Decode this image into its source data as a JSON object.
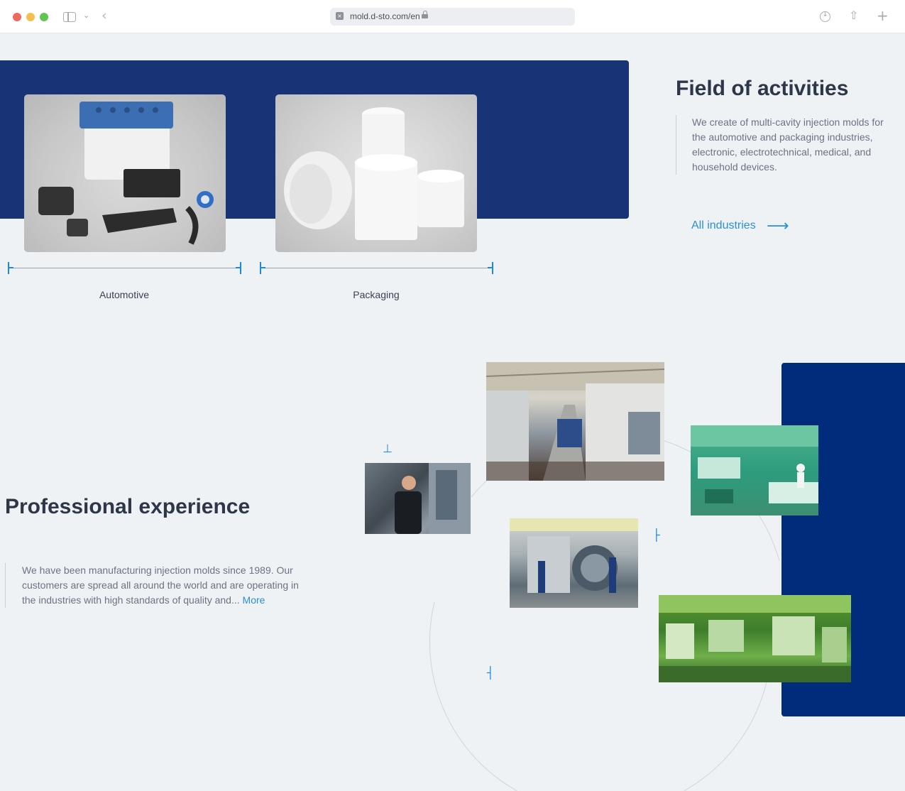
{
  "browser": {
    "url": "mold.d-sto.com/en"
  },
  "fields": {
    "title": "Field of activities",
    "description": "We create of multi-cavity injection molds for the automotive and packaging industries, electronic, electrotechnical, medical, and household devices.",
    "all_link": "All industries",
    "industries": [
      {
        "label": "Automotive"
      },
      {
        "label": "Packaging"
      }
    ]
  },
  "experience": {
    "title": "Professional experience",
    "description": "We have been manufacturing injection molds since 1989. Our customers are spread all around the world and are operating in the industries with high standards of quality and...",
    "more_link": "More"
  },
  "colors": {
    "brand_blue": "#183476",
    "accent_blue": "#2b8fd6"
  }
}
